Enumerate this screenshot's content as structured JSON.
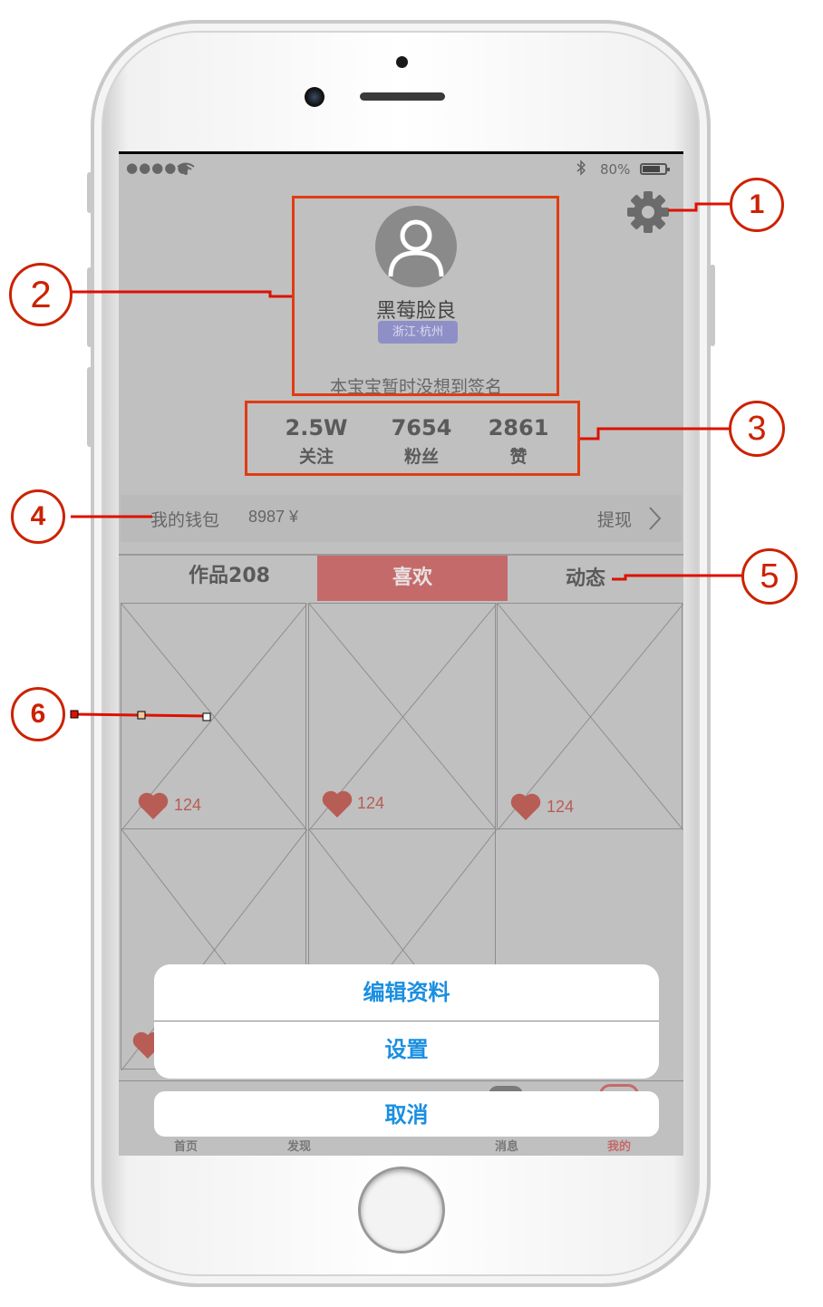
{
  "status_bar": {
    "battery": "80%"
  },
  "profile": {
    "name": "黑莓脸良",
    "location": "浙江·杭州",
    "signature": "本宝宝暂时没想到签名"
  },
  "stats": [
    {
      "value": "2.5W",
      "label": "关注"
    },
    {
      "value": "7654",
      "label": "粉丝"
    },
    {
      "value": "2861",
      "label": "赞"
    }
  ],
  "wallet": {
    "label": "我的钱包",
    "amount": "8987 ¥",
    "withdraw": "提现"
  },
  "tabs": [
    {
      "label": "作品208"
    },
    {
      "label": "喜欢"
    },
    {
      "label": "动态"
    }
  ],
  "grid_items": [
    {
      "likes": "124"
    },
    {
      "likes": "124"
    },
    {
      "likes": "124"
    }
  ],
  "bottom_nav": [
    "首页",
    "发现",
    "消息",
    "我的"
  ],
  "action_sheet": {
    "edit_profile": "编辑资料",
    "settings": "设置",
    "cancel": "取消"
  },
  "callouts": [
    "1",
    "2",
    "3",
    "4",
    "5",
    "6"
  ],
  "colors": {
    "annotation_red": "#e03c12",
    "accent_tab": "#c46a6a",
    "heart": "#b85c56",
    "location_badge": "#8f8fc8",
    "action_text": "#1a8fe0"
  }
}
